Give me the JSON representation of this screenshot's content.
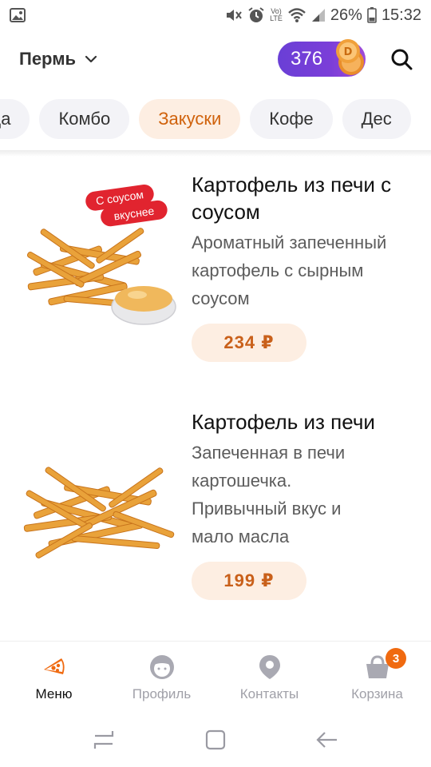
{
  "status_bar": {
    "battery": "26%",
    "time": "15:32",
    "icons": [
      "image-icon",
      "mute-icon",
      "alarm-icon",
      "volte-icon",
      "wifi-icon",
      "signal-icon",
      "battery-icon"
    ],
    "volte_label_top": "Vo)",
    "volte_label_bottom": "LTE"
  },
  "header": {
    "city": "Пермь",
    "coins": "376"
  },
  "tabs": [
    {
      "label": "цца",
      "active": false
    },
    {
      "label": "Комбо",
      "active": false
    },
    {
      "label": "Закуски",
      "active": true
    },
    {
      "label": "Кофе",
      "active": false
    },
    {
      "label": "Дес",
      "active": false
    }
  ],
  "products": [
    {
      "title": "Картофель из печи с соусом",
      "description": "Ароматный запеченный картофель с сырным соусом",
      "price": "234 ₽",
      "badge_line1": "С соусом",
      "badge_line2": "вкуснее"
    },
    {
      "title": "Картофель из печи",
      "description": "Запеченная в печи картошечка. Привычный вкус и мало масла",
      "price": "199 ₽"
    }
  ],
  "bottom_nav": {
    "menu": "Меню",
    "profile": "Профиль",
    "contacts": "Контакты",
    "cart": "Корзина",
    "cart_count": "3"
  },
  "colors": {
    "accent": "#d0620c",
    "accent_bg": "#fdeee2",
    "coins_purple": "#6a3fd6",
    "badge_orange": "#f06a10"
  }
}
